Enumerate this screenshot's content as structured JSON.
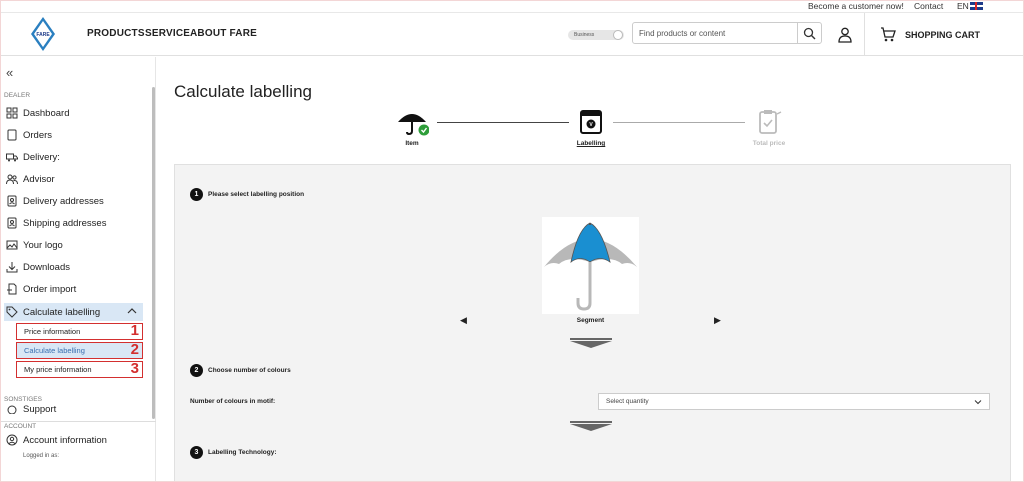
{
  "topbar": {
    "become": "Become a customer now!",
    "contact": "Contact",
    "lang": "EN"
  },
  "header": {
    "logo_text": "FARE",
    "nav": [
      "PRODUCTS",
      "SERVICE",
      "ABOUT FARE"
    ],
    "business_toggle": "Business",
    "search_placeholder": "Find products or content",
    "cart_label": "SHOPPING CART"
  },
  "sidebar": {
    "dealer_label": "DEALER",
    "items": [
      {
        "label": "Dashboard",
        "icon": "dashboard-icon"
      },
      {
        "label": "Orders",
        "icon": "orders-icon"
      },
      {
        "label": "Delivery:",
        "icon": "truck-icon"
      },
      {
        "label": "Advisor",
        "icon": "advisor-icon"
      },
      {
        "label": "Delivery addresses",
        "icon": "address-book-icon"
      },
      {
        "label": "Shipping addresses",
        "icon": "address-book-icon"
      },
      {
        "label": "Your logo",
        "icon": "image-icon"
      },
      {
        "label": "Downloads",
        "icon": "download-icon"
      },
      {
        "label": "Order import",
        "icon": "file-import-icon"
      },
      {
        "label": "Calculate labelling",
        "icon": "tag-icon"
      }
    ],
    "subitems": [
      {
        "label": "Price information",
        "num": "1"
      },
      {
        "label": "Calculate labelling",
        "num": "2"
      },
      {
        "label": "My price information",
        "num": "3"
      }
    ],
    "sonstiges_label": "SONSTIGES",
    "support_label": "Support",
    "account_label": "ACCOUNT",
    "account_info": "Account information",
    "logged_in": "Logged in as:"
  },
  "main": {
    "title": "Calculate labelling",
    "steps": [
      "Item",
      "Labelling",
      "Total price"
    ],
    "q1": {
      "num": "1",
      "label": "Please select labelling position"
    },
    "segment_label": "Segment",
    "q2": {
      "num": "2",
      "label": "Choose number of colours"
    },
    "colours_field_label": "Number of colours in motif:",
    "select_placeholder": "Select quantity",
    "q3": {
      "num": "3",
      "label": "Labelling Technology:"
    }
  },
  "colors": {
    "accent_blue": "#1a8fd1",
    "umbrella_grey": "#b8b8b8",
    "step_check": "#2e9e3a",
    "highlight_red": "#d32f2f",
    "active_bg": "#d9e7f5"
  }
}
